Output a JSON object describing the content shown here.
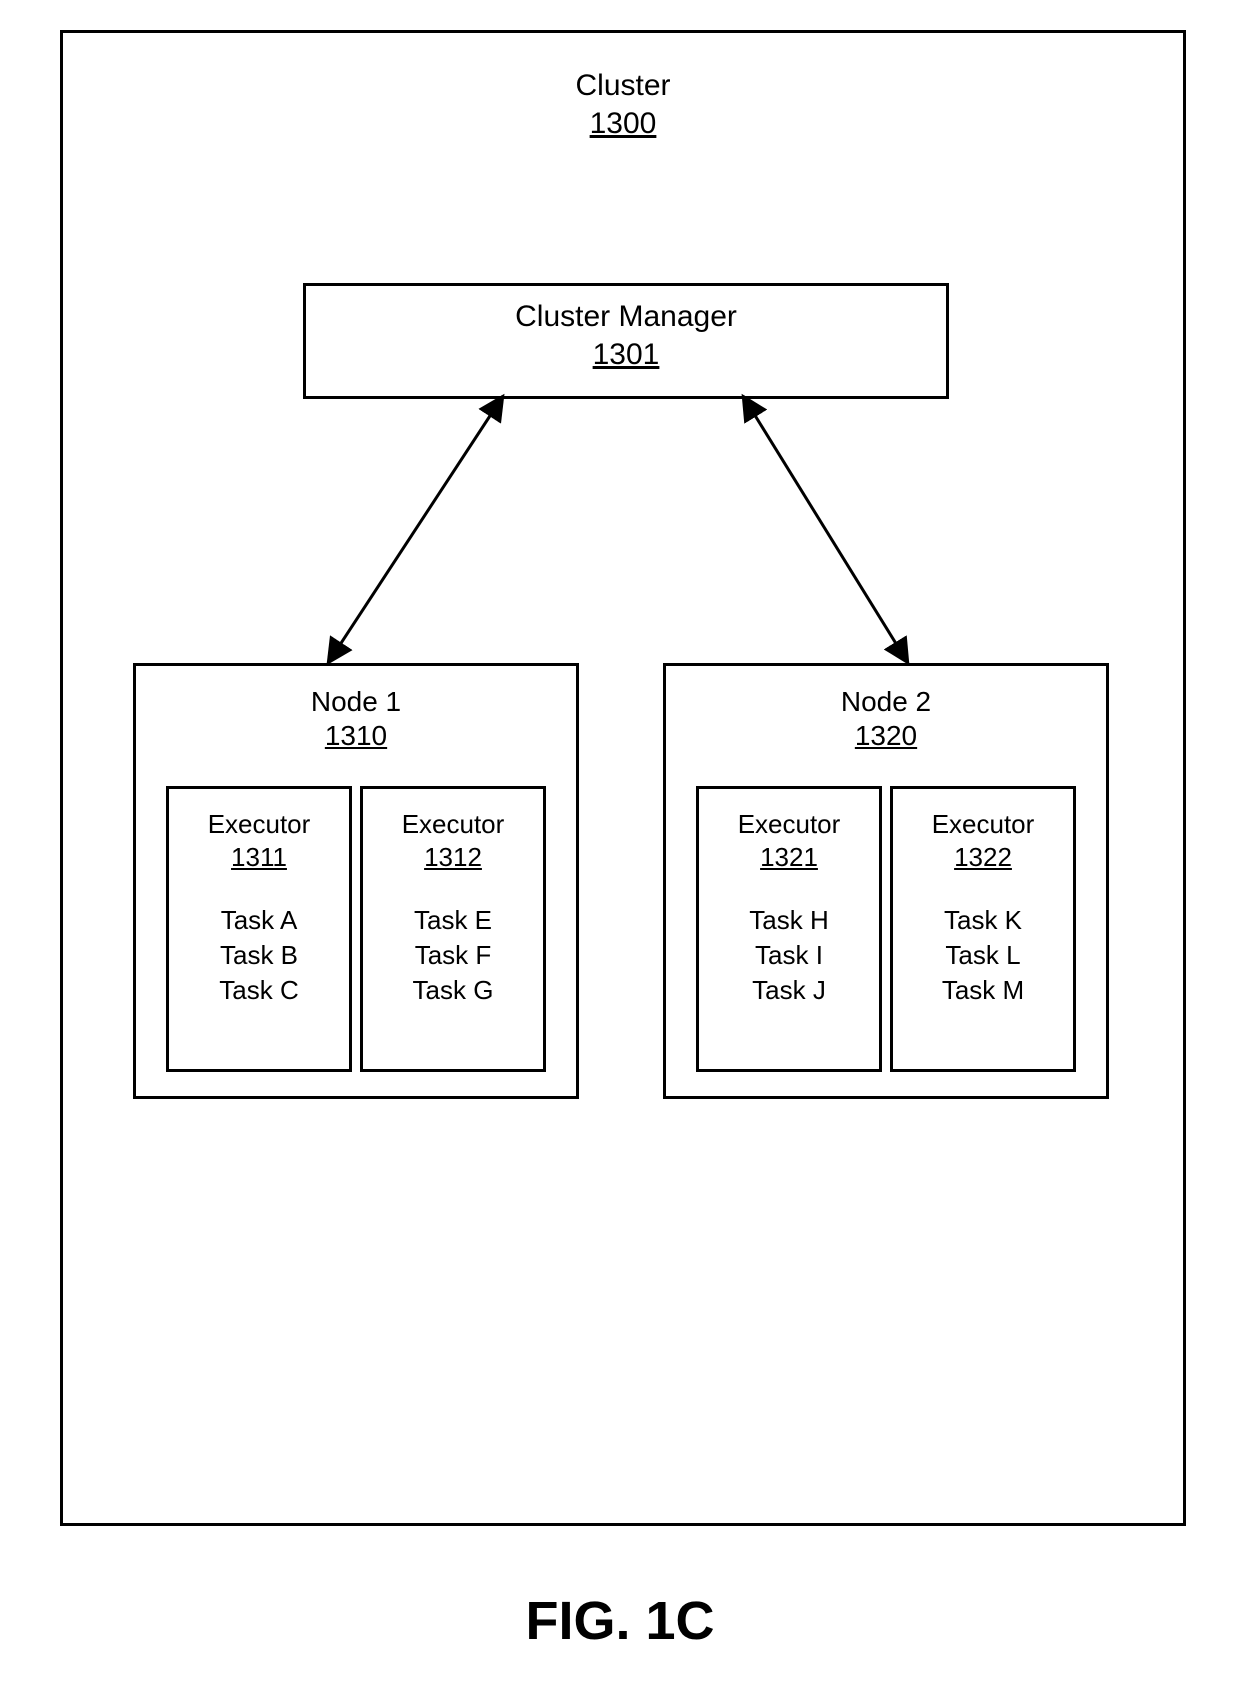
{
  "figure_caption": "FIG. 1C",
  "cluster": {
    "title": "Cluster",
    "ref": "1300",
    "manager": {
      "label": "Cluster Manager",
      "ref": "1301"
    },
    "nodes": [
      {
        "title": "Node 1",
        "ref": "1310",
        "executors": [
          {
            "label": "Executor",
            "ref": "1311",
            "tasks": [
              "Task A",
              "Task B",
              "Task C"
            ]
          },
          {
            "label": "Executor",
            "ref": "1312",
            "tasks": [
              "Task E",
              "Task F",
              "Task G"
            ]
          }
        ]
      },
      {
        "title": "Node 2",
        "ref": "1320",
        "executors": [
          {
            "label": "Executor",
            "ref": "1321",
            "tasks": [
              "Task H",
              "Task I",
              "Task J"
            ]
          },
          {
            "label": "Executor",
            "ref": "1322",
            "tasks": [
              "Task K",
              "Task L",
              "Task M"
            ]
          }
        ]
      }
    ]
  }
}
